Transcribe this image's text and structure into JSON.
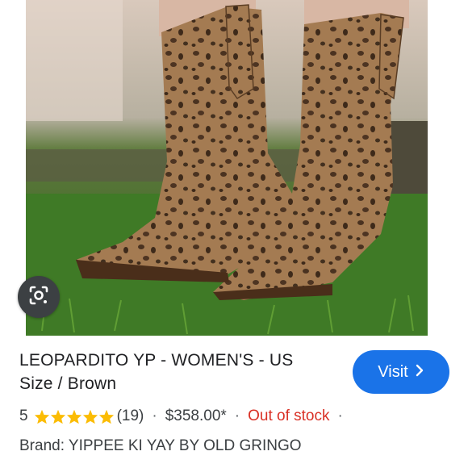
{
  "product": {
    "title_line1": "LEOPARDITO YP - WOMEN'S - US",
    "title_line2": "Size / Brown",
    "rating": "5",
    "stars": 5,
    "review_count": "(19)",
    "price": "$358.00*",
    "stock_status": "Out of stock",
    "brand_label": "Brand:",
    "brand": "YIPPEE KI YAY BY OLD GRINGO"
  },
  "actions": {
    "visit_label": "Visit"
  },
  "separators": {
    "dot": "·"
  },
  "icons": {
    "lens": "lens-icon",
    "chevron": "chevron-right-icon",
    "star": "star-icon"
  },
  "colors": {
    "visit_button": "#1a73e8",
    "star": "#fbbc04",
    "out_of_stock": "#d93025",
    "text": "#202124"
  }
}
